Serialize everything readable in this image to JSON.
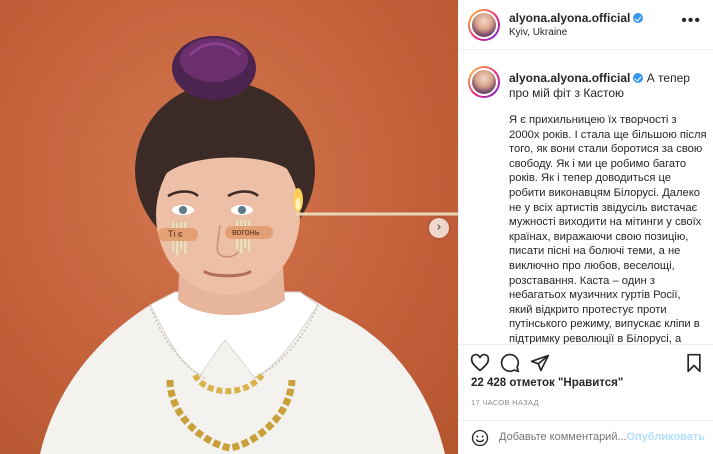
{
  "post": {
    "image_alt": "",
    "next_glyph": "›"
  },
  "header": {
    "username": "alyona.alyona.official",
    "location": "Kyiv, Ukraine",
    "more_glyph": "•••",
    "verified_icon": "verified-badge-icon"
  },
  "caption": {
    "username": "alyona.alyona.official",
    "title": "А тепер про мій фіт з Кастою",
    "body": "Я є прихильницею їх творчості з 2000х років. І стала ще більшою після того, як вони стали боротися за свою свободу. Як і ми це робимо багато років. Як і тепер доводиться це робити виконавцям Білорусі. Далеко не у всіх артистів звідусіль вистачає мужності виходити на мітинги у своїх країнах, виражаючи свою позицію, писати пісні на болючі теми, а не виключно про любов, веселощі, розставання. Каста – один з небагатьох музичних гуртів Росії, який відкрито протестує проти путінського режиму, випускає кліпи в підтримку революції в Білорусі, а учасники гурту постійно"
  },
  "photo_text": {
    "left_patch": "Ті є",
    "right_patch": "вогонь"
  },
  "actions": {
    "icons": [
      "heart-icon",
      "comment-icon",
      "share-icon",
      "bookmark-icon"
    ]
  },
  "likes": {
    "text": "22 428 отметок \"Нравится\""
  },
  "timestamp": "17 ЧАСОВ НАЗАД",
  "comment_box": {
    "placeholder": "Добавьте комментарий...",
    "publish_label": "Опубликовать",
    "emoji_icon": "emoji-icon"
  },
  "colors": {
    "background_photo": "#c4623c",
    "verified": "#3897f0",
    "publish_disabled": "#b2dffc"
  }
}
